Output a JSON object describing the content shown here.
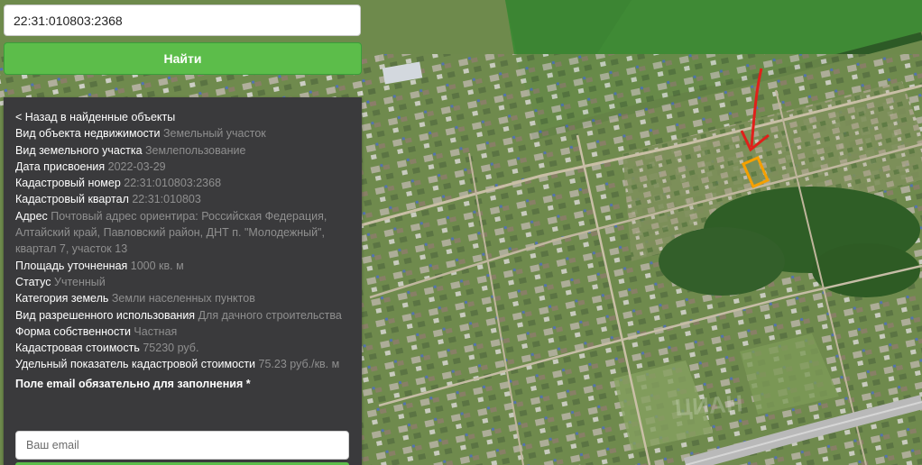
{
  "search": {
    "value": "22:31:010803:2368",
    "button_label": "Найти"
  },
  "panel": {
    "back_label": "< Назад в найденные объекты",
    "fields": [
      {
        "key": "Вид объекта недвижимости",
        "value": "Земельный участок"
      },
      {
        "key": "Вид земельного участка",
        "value": "Землепользование"
      },
      {
        "key": "Дата присвоения",
        "value": "2022-03-29"
      },
      {
        "key": "Кадастровый номер",
        "value": "22:31:010803:2368"
      },
      {
        "key": "Кадастровый квартал",
        "value": "22:31:010803"
      },
      {
        "key": "Адрес",
        "value": "Почтовый адрес ориентира: Российская Федерация, Алтайский край, Павловский район, ДНТ п. \"Молодежный\", квартал 7, участок 13"
      },
      {
        "key": "Площадь уточненная",
        "value": "1000 кв. м"
      },
      {
        "key": "Статус",
        "value": "Учтенный"
      },
      {
        "key": "Категория земель",
        "value": "Земли населенных пунктов"
      },
      {
        "key": "Вид разрешенного использования",
        "value": "Для дачного строительства"
      },
      {
        "key": "Форма собственности",
        "value": "Частная"
      },
      {
        "key": "Кадастровая стоимость",
        "value": "75230 руб."
      },
      {
        "key": "Удельный показатель кадастровой стоимости",
        "value": "75.23 руб./кв. м"
      }
    ],
    "form_title": "Поле email обязательно для заполнения *",
    "email_placeholder": "Ваш email"
  },
  "map": {
    "watermark": "ЦИАН",
    "marker_color": "#f5a000",
    "arrow_color": "#e0201a"
  }
}
